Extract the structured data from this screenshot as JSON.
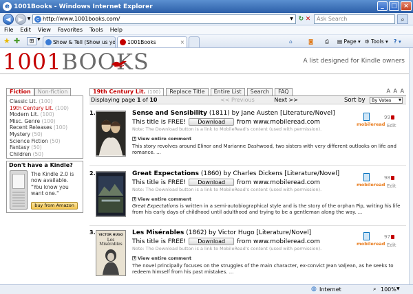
{
  "window": {
    "title": "1001Books - Windows Internet Explorer",
    "address": "http://www.1001books.com/",
    "search_placeholder": "Ask Search"
  },
  "menu": [
    "File",
    "Edit",
    "View",
    "Favorites",
    "Tools",
    "Help"
  ],
  "browser_tabs": [
    {
      "label": "Show & Tell (Show us your h...",
      "active": false
    },
    {
      "label": "1001Books",
      "active": true
    }
  ],
  "commands": {
    "page": "Page",
    "tools": "Tools"
  },
  "status": {
    "zone": "Internet",
    "zoom": "100%"
  },
  "site": {
    "logo_num": "1001",
    "logo_word": "BOOKS",
    "tagline": "A list designed for Kindle owners"
  },
  "side_tabs": [
    "Fiction",
    "Non-fiction"
  ],
  "categories": [
    {
      "name": "Classic Lit.",
      "count": "(100)",
      "active": false
    },
    {
      "name": "19th Century Lit.",
      "count": "(100)",
      "active": true
    },
    {
      "name": "Modern Lit.",
      "count": "(100)",
      "active": false
    },
    {
      "name": "Misc. Genre",
      "count": "(100)",
      "active": false
    },
    {
      "name": "Recent Releases",
      "count": "(100)",
      "active": false
    },
    {
      "name": "Mystery",
      "count": "(50)",
      "active": false
    },
    {
      "name": "Science Fiction",
      "count": "(50)",
      "active": false
    },
    {
      "name": "Fantasy",
      "count": "(50)",
      "active": false
    },
    {
      "name": "Children",
      "count": "(50)",
      "active": false
    }
  ],
  "kindle": {
    "title": "Don't have a Kindle?",
    "text1": "The Kindle 2.0 is now available.",
    "text2": "\"You know you want one.\"",
    "button": "buy from Amazon"
  },
  "top_tabs": [
    {
      "label": "19th Century Lit.",
      "count": "(100)",
      "active": true
    },
    {
      "label": "Replace Title",
      "count": "",
      "active": false
    },
    {
      "label": "Entire List",
      "count": "",
      "active": false
    },
    {
      "label": "Search",
      "count": "",
      "active": false
    },
    {
      "label": "FAQ",
      "count": "",
      "active": false
    }
  ],
  "font_size_label": "A A A",
  "paging": {
    "prefix": "Displaying page ",
    "page": "1",
    "of": " of ",
    "total": "10",
    "prev": "<< Previous",
    "next": "Next >>",
    "sort_label": "Sort by",
    "sort_value": "By Votes"
  },
  "book_common": {
    "free_text": "This title is FREE!",
    "download": "Download",
    "from": "from",
    "site": "www.mobileread.com",
    "note": "Note: The Download button is a link to MobileRead's content (used with permission).",
    "view_comment": "View entire comment",
    "mobileread": "mobileread",
    "edit": "Edit"
  },
  "books": [
    {
      "num": "1.",
      "title": "Sense and Sensibility",
      "meta": "(1811) by Jane Austen [Literature/Novel]",
      "desc_italic": "",
      "desc": "This story revolves around Elinor and Marianne Dashwood, two sisters with very different outlooks on life and romance. ...",
      "votes": "99"
    },
    {
      "num": "2.",
      "title": "Great Expectations",
      "meta": "(1860) by Charles Dickens [Literature/Novel]",
      "desc_italic": "Great Expectations",
      "desc": " is written in a semi-autobiographical style and is the story of the orphan Pip, writing his life from his early days of childhood until adulthood and trying to be a gentleman along the way. ...",
      "votes": "98"
    },
    {
      "num": "3.",
      "title": "Les Misérables",
      "meta": "(1862) by Victor Hugo [Literature/Novel]",
      "desc_italic": "",
      "desc": "The novel principally focuses on the struggles of the main character, ex-convict Jean Valjean, as he seeks to redeem himself from his past mistakes. ...",
      "votes": "97",
      "cover_author": "VICTOR HUGO",
      "cover_title": "Les Misérables"
    }
  ]
}
